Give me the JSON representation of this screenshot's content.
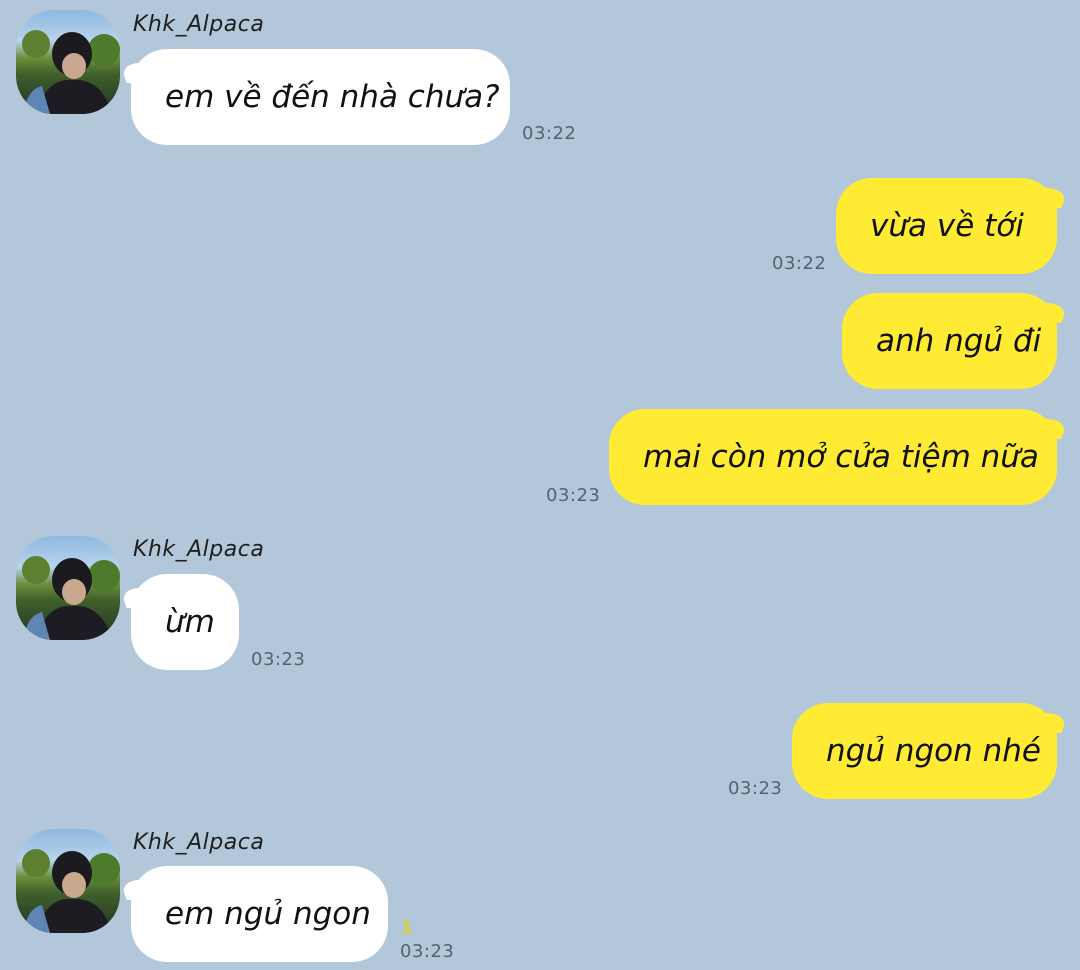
{
  "contact": {
    "name": "Khk_Alpaca"
  },
  "messages": [
    {
      "side": "in",
      "text": "em về đến nhà chưa?",
      "time": "03:22"
    },
    {
      "side": "out",
      "text": "vừa về tới",
      "time": "03:22"
    },
    {
      "side": "out",
      "text": "anh ngủ đi",
      "time": ""
    },
    {
      "side": "out",
      "text": "mai còn mở cửa tiệm nữa",
      "time": "03:23"
    },
    {
      "side": "in",
      "text": "ừm",
      "time": "03:23"
    },
    {
      "side": "out",
      "text": "ngủ ngon nhé",
      "time": "03:23"
    },
    {
      "side": "in",
      "text": "em ngủ ngon",
      "time": "03:23",
      "unread": "1"
    }
  ],
  "colors": {
    "background": "#b2c7d9",
    "incoming_bubble": "#ffffff",
    "outgoing_bubble": "#ffeb33",
    "unread_count": "#e2cd2a"
  },
  "icons": {
    "avatar": "profile-photo"
  }
}
